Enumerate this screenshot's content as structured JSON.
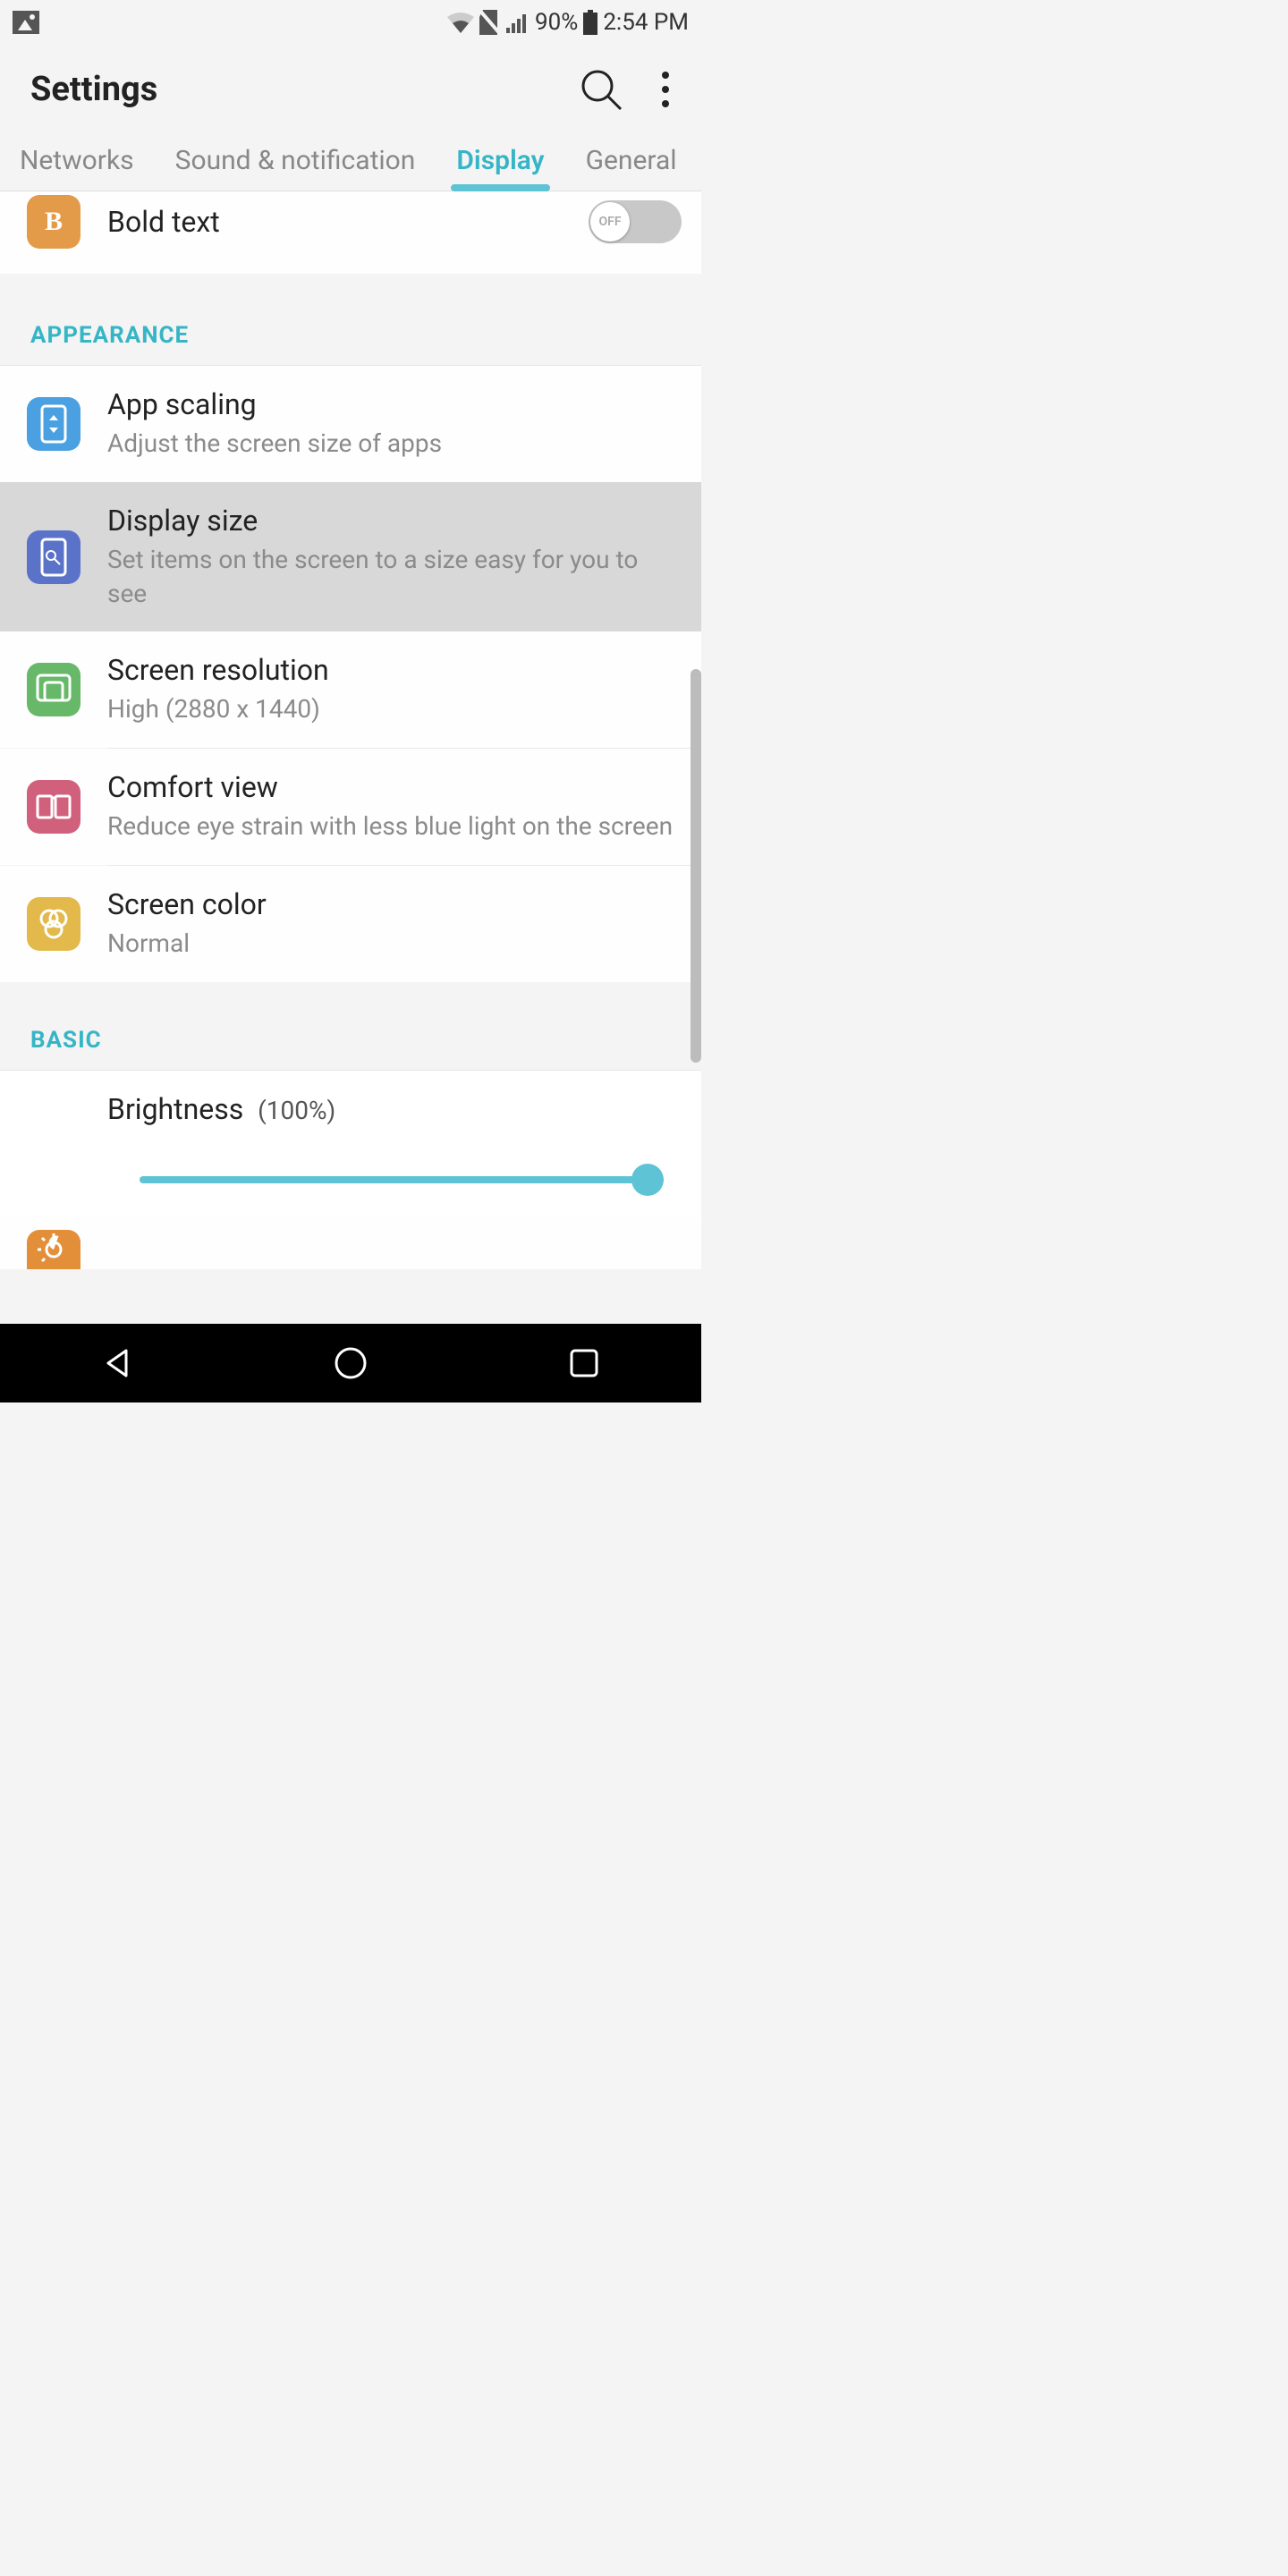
{
  "status": {
    "battery_pct": "90%",
    "time": "2:54 PM"
  },
  "header": {
    "title": "Settings"
  },
  "tabs": [
    "Networks",
    "Sound & notification",
    "Display",
    "General"
  ],
  "active_tab": "Display",
  "bold_text": {
    "title": "Bold text",
    "toggle_label": "OFF"
  },
  "sections": {
    "appearance": {
      "label": "APPEARANCE",
      "items": {
        "app_scaling": {
          "title": "App scaling",
          "subtitle": "Adjust the screen size of apps"
        },
        "display_size": {
          "title": "Display size",
          "subtitle": "Set items on the screen to a size easy for you to see"
        },
        "screen_resolution": {
          "title": "Screen resolution",
          "subtitle": "High (2880 x 1440)"
        },
        "comfort_view": {
          "title": "Comfort view",
          "subtitle": "Reduce eye strain with less blue light on the screen"
        },
        "screen_color": {
          "title": "Screen color",
          "subtitle": "Normal"
        }
      }
    },
    "basic": {
      "label": "BASIC",
      "brightness": {
        "title": "Brightness",
        "percent": "(100%)",
        "value": 100
      }
    }
  },
  "colors": {
    "orange": "#e39b49",
    "blue": "#5a73c9",
    "green": "#67b868",
    "pink": "#d0607c",
    "yellow": "#e2b94a",
    "accent": "#5ec3d4"
  }
}
